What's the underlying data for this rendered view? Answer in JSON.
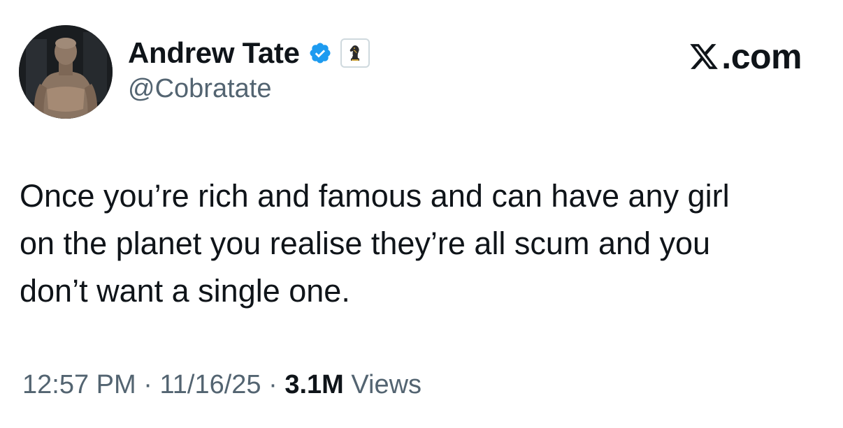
{
  "tweet": {
    "author": {
      "display_name": "Andrew Tate",
      "handle": "@Cobratate",
      "verified_icon": "verified-badge-icon",
      "affiliate_icon": "chess-knight-icon",
      "avatar": "profile-photo"
    },
    "brand": {
      "label": ".com",
      "logo_icon": "x-logo-icon"
    },
    "text_lines": [
      "Once you’re rich and famous and can have any girl",
      "on the planet you realise they’re all scum and you",
      "don’t want a single one."
    ],
    "meta": {
      "time": "12:57 PM",
      "separator": "·",
      "date": "11/16/25",
      "views_count": "3.1M",
      "views_label": "Views"
    }
  },
  "colors": {
    "text_primary": "#0f1419",
    "text_secondary": "#536471",
    "verified_blue": "#1d9bf0",
    "badge_gold": "#c8a03a"
  }
}
